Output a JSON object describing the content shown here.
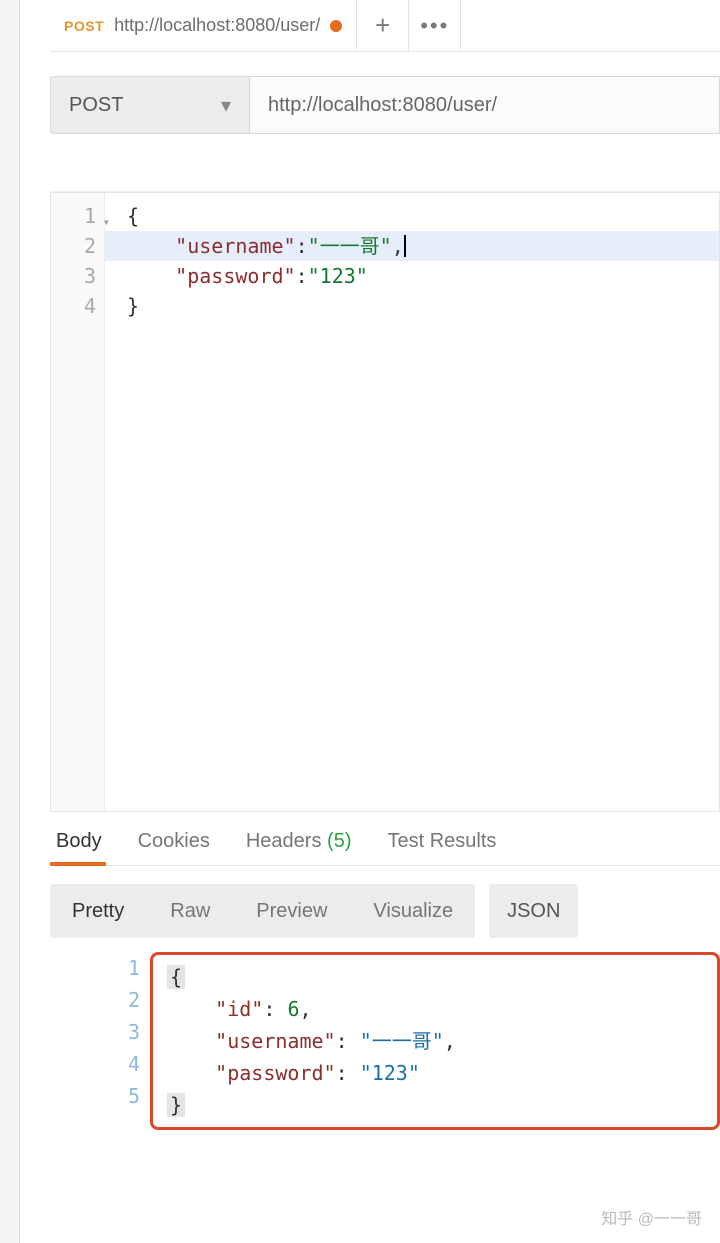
{
  "tab": {
    "method": "POST",
    "url": "http://localhost:8080/user/",
    "dirty": true
  },
  "request": {
    "method": "POST",
    "url": "http://localhost:8080/user/"
  },
  "editor": {
    "lines": [
      "1",
      "2",
      "3",
      "4"
    ],
    "body": {
      "l1": "{",
      "l2_key": "\"username\"",
      "l2_val": "\"一一哥\"",
      "l3_key": "\"password\"",
      "l3_val": "\"123\"",
      "l4": "}"
    }
  },
  "response_tabs": {
    "body": "Body",
    "cookies": "Cookies",
    "headers": "Headers",
    "headers_count": "(5)",
    "test_results": "Test Results"
  },
  "response_toolbar": {
    "pretty": "Pretty",
    "raw": "Raw",
    "preview": "Preview",
    "visualize": "Visualize",
    "format": "JSON"
  },
  "response_body": {
    "lines": [
      "1",
      "2",
      "3",
      "4",
      "5"
    ],
    "l1": "{",
    "l2_key": "\"id\"",
    "l2_val": "6",
    "l3_key": "\"username\"",
    "l3_val": "\"一一哥\"",
    "l4_key": "\"password\"",
    "l4_val": "\"123\"",
    "l5": "}"
  },
  "watermark": "知乎 @一一哥"
}
